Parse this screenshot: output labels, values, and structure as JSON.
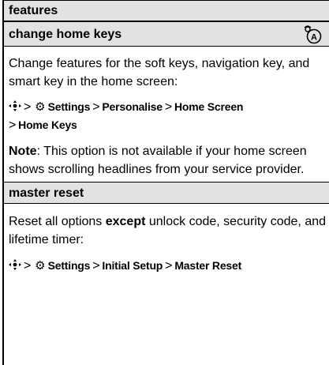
{
  "section_header": "features",
  "change_home_keys": {
    "title": "change home keys",
    "icon": "network-feature-icon",
    "description": "Change features for the soft keys, navigation key, and smart key in the home screen:",
    "path": {
      "nav_icon": "navigation-key-icon",
      "settings_icon": "settings-icon",
      "step1": "Settings",
      "step2": "Personalise",
      "step3": "Home Screen",
      "step4": "Home Keys",
      "separator": ">"
    },
    "note_label": "Note",
    "note_text": ": This option is not available if your home screen shows scrolling headlines from your service provider."
  },
  "master_reset": {
    "title": "master reset",
    "description_before": "Reset all options ",
    "description_bold": "except",
    "description_after": " unlock code, security code, and lifetime timer:",
    "path": {
      "nav_icon": "navigation-key-icon",
      "settings_icon": "settings-icon",
      "step1": "Settings",
      "step2": "Initial Setup",
      "step3": "Master Reset",
      "separator": ">"
    }
  }
}
